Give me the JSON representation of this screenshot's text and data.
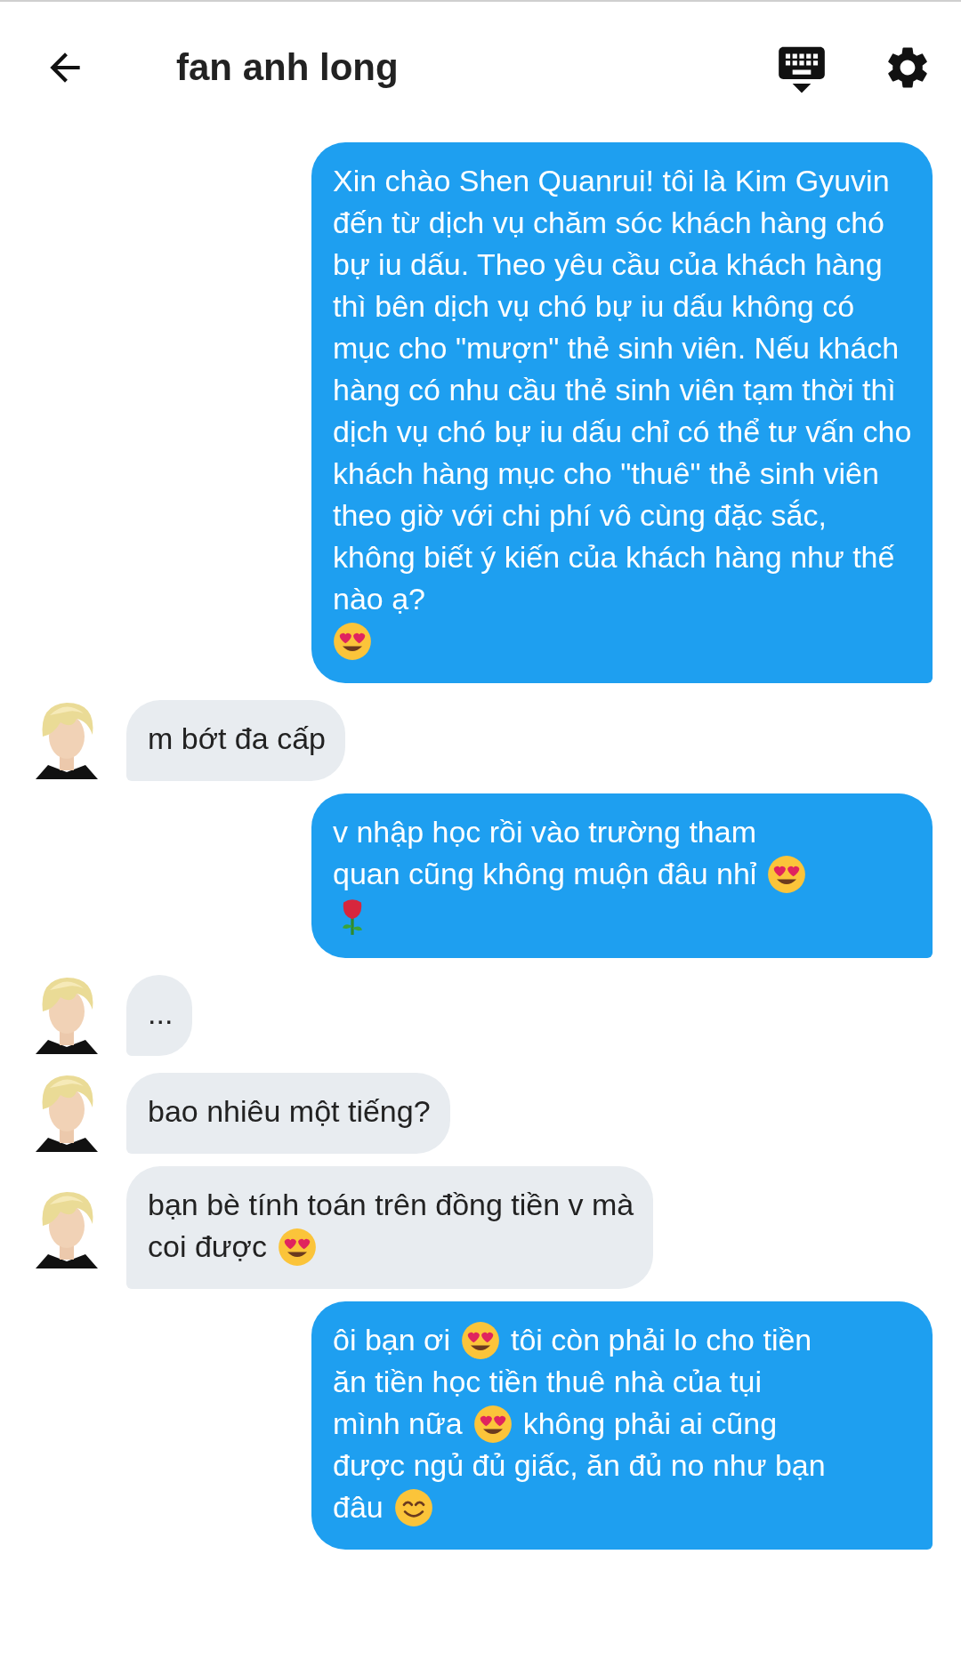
{
  "header": {
    "title": "fan anh long"
  },
  "messages": [
    {
      "kind": "outgoing",
      "lines": [
        [
          {
            "kind": "text",
            "text": "Xin chào Shen Quanrui! tôi là Kim Gyuvin đến từ dịch vụ chăm sóc khách hàng chó bự iu dấu. Theo yêu cầu của khách hàng thì bên dịch vụ chó bự iu dấu không có mục cho \"mượn\" thẻ sinh viên. Nếu khách hàng có nhu cầu thẻ sinh viên tạm thời thì dịch vụ chó bự iu dấu chỉ có thể tư vấn cho khách hàng mục cho \"thuê\" thẻ sinh viên theo giờ với chi phí vô cùng đặc sắc, không biết ý kiến của khách hàng như thế nào ạ?"
          }
        ],
        [
          {
            "kind": "heart_eyes"
          }
        ]
      ]
    },
    {
      "kind": "incoming",
      "lines": [
        [
          {
            "kind": "text",
            "text": "m bớt đa cấp"
          }
        ]
      ]
    },
    {
      "kind": "outgoing",
      "lines": [
        [
          {
            "kind": "text",
            "text": "v nhập học rồi vào trường tham"
          }
        ],
        [
          {
            "kind": "text",
            "text": "quan cũng không muộn đâu nhỉ"
          },
          {
            "kind": "heart_eyes"
          }
        ],
        [
          {
            "kind": "rose"
          }
        ]
      ]
    },
    {
      "kind": "incoming",
      "lines": [
        [
          {
            "kind": "text",
            "text": "..."
          }
        ]
      ]
    },
    {
      "kind": "incoming",
      "lines": [
        [
          {
            "kind": "text",
            "text": "bao nhiêu một tiếng?"
          }
        ]
      ]
    },
    {
      "kind": "incoming",
      "lines": [
        [
          {
            "kind": "text",
            "text": "bạn bè tính toán trên đồng tiền v mà"
          }
        ],
        [
          {
            "kind": "text",
            "text": "coi được"
          },
          {
            "kind": "heart_eyes"
          }
        ]
      ]
    },
    {
      "kind": "outgoing",
      "lines": [
        [
          {
            "kind": "text",
            "text": "ôi bạn ơi"
          },
          {
            "kind": "heart_eyes"
          },
          {
            "kind": "text",
            "text": "tôi còn phải lo cho tiền"
          }
        ],
        [
          {
            "kind": "text",
            "text": "ăn tiền học tiền thuê nhà của tụi"
          }
        ],
        [
          {
            "kind": "text",
            "text": "mình nữa"
          },
          {
            "kind": "heart_eyes"
          },
          {
            "kind": "text",
            "text": "không phải ai cũng"
          }
        ],
        [
          {
            "kind": "text",
            "text": "được ngủ đủ giấc, ăn đủ no như bạn"
          }
        ],
        [
          {
            "kind": "text",
            "text": "đâu"
          },
          {
            "kind": "smile"
          }
        ]
      ]
    }
  ]
}
